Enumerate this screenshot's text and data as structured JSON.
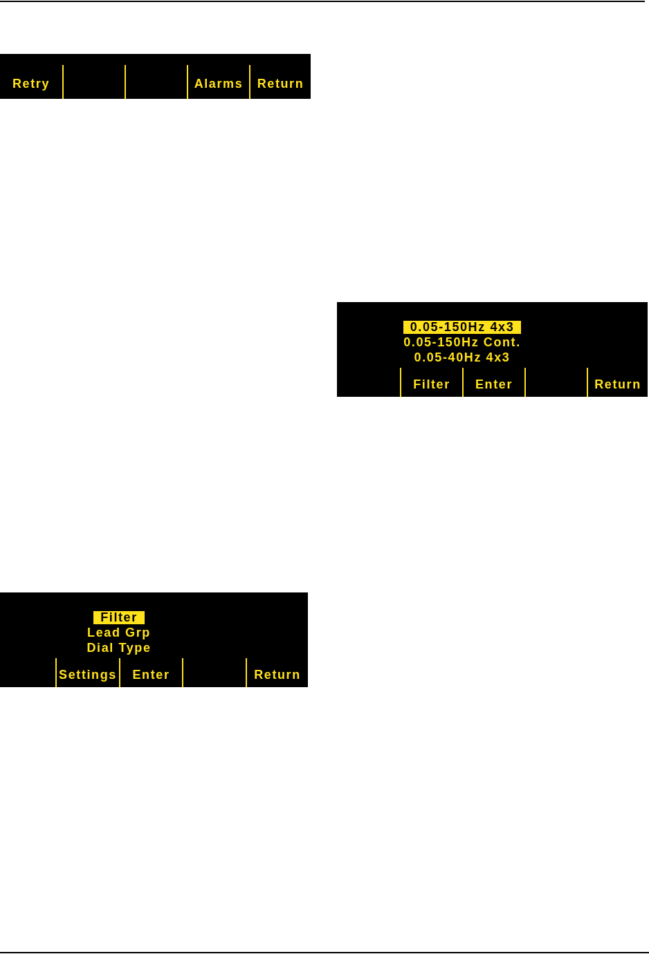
{
  "panels": [
    {
      "softkeys": [
        "Retry",
        "Alarms",
        "Return"
      ]
    },
    {
      "menu": [
        {
          "label": "0.05-150Hz 4x3",
          "selected": true
        },
        {
          "label": "0.05-150Hz Cont.",
          "selected": false
        },
        {
          "label": "0.05-40Hz 4x3",
          "selected": false
        }
      ],
      "softkeys": [
        "Filter",
        "Enter",
        "Return"
      ]
    },
    {
      "menu": [
        {
          "label": "Filter",
          "selected": true
        },
        {
          "label": "Lead Grp",
          "selected": false
        },
        {
          "label": "Dial Type",
          "selected": false
        }
      ],
      "softkeys": [
        "Settings",
        "Enter",
        "Return"
      ]
    }
  ]
}
